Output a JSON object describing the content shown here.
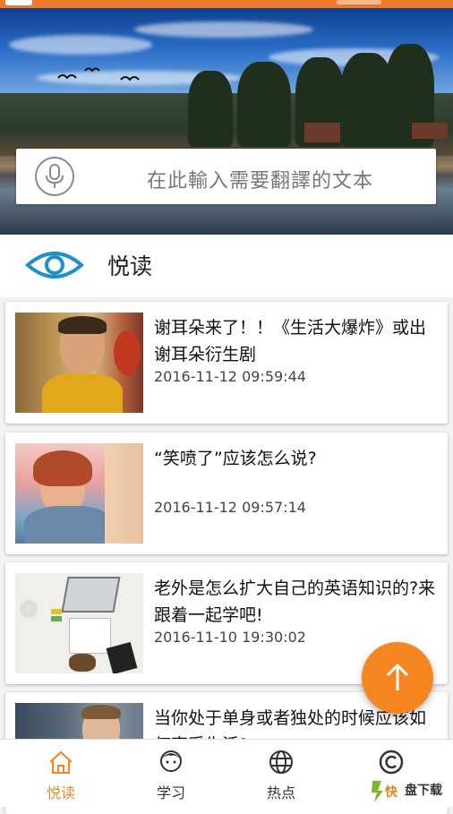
{
  "search": {
    "placeholder": "在此輸入需要翻譯的文本"
  },
  "section": {
    "title": "悦读"
  },
  "articles": [
    {
      "title": "谢耳朵来了！！《生活大爆炸》或出谢耳朵衍生剧",
      "time": "2016-11-12 09:59:44"
    },
    {
      "title": "“笑喷了”应该怎么说?",
      "time": "2016-11-12 09:57:14"
    },
    {
      "title": "老外是怎么扩大自己的英语知识的?来跟着一起学吧!",
      "time": "2016-11-10 19:30:02"
    },
    {
      "title": "当你处于单身或者独处的时候应该如何享受生活?",
      "time": ""
    }
  ],
  "nav": {
    "items": [
      {
        "label": "悦读",
        "icon": "home-icon",
        "active": true
      },
      {
        "label": "学习",
        "icon": "person-icon",
        "active": false
      },
      {
        "label": "热点",
        "icon": "globe-icon",
        "active": false
      },
      {
        "label": "",
        "icon": "copyright-icon",
        "active": false
      }
    ]
  },
  "watermark": {
    "text": "盘下载"
  },
  "colors": {
    "accent": "#f5861f",
    "active_nav": "#f5861f",
    "inactive_nav": "#333333",
    "eye": "#1f8fc9"
  }
}
